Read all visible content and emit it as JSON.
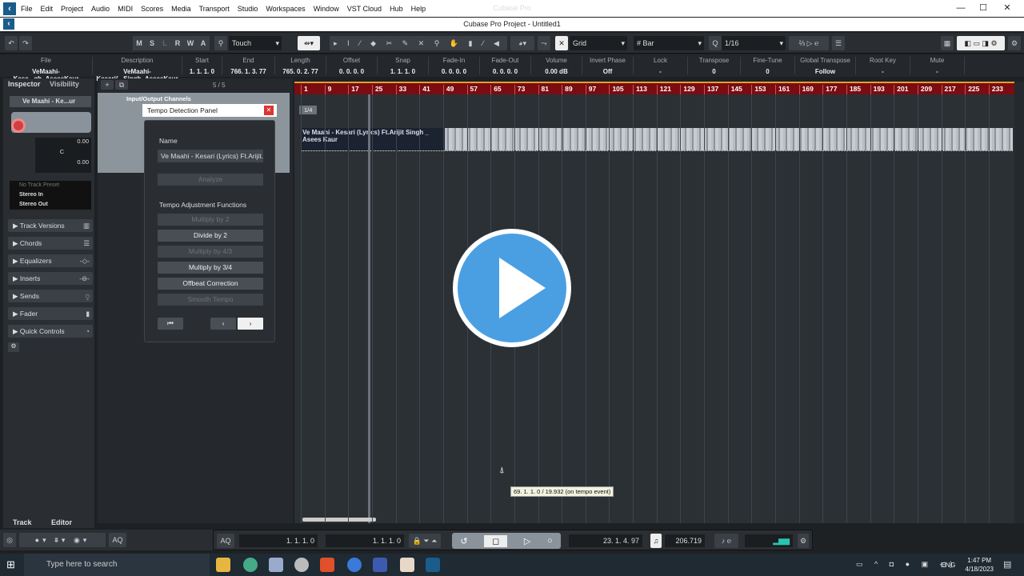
{
  "app": {
    "window_title": "Cubase Pro",
    "project_title": "Cubase Pro Project - Untitled1",
    "menu": [
      "File",
      "Edit",
      "Project",
      "Audio",
      "MIDI",
      "Scores",
      "Media",
      "Transport",
      "Studio",
      "Workspaces",
      "Window",
      "VST Cloud",
      "Hub",
      "Help"
    ]
  },
  "toolbar": {
    "modes": [
      "M",
      "S",
      "L",
      "R",
      "W",
      "A"
    ],
    "automation_mode": "Touch",
    "snap_type": "Grid",
    "grid_type": "Bar",
    "quantize": "1/16"
  },
  "infoline": [
    {
      "label": "File",
      "value": "VeMaahi-Kesa...gh_AseesKaur"
    },
    {
      "label": "Description",
      "value": "VeMaahi-Kesari(...Singh_AseesKaur"
    },
    {
      "label": "Start",
      "value": "1. 1. 1. 0"
    },
    {
      "label": "End",
      "value": "766. 1. 3. 77"
    },
    {
      "label": "Length",
      "value": "765. 0. 2. 77"
    },
    {
      "label": "Offset",
      "value": "0. 0. 0. 0"
    },
    {
      "label": "Snap",
      "value": "1. 1. 1. 0"
    },
    {
      "label": "Fade-In",
      "value": "0. 0. 0. 0"
    },
    {
      "label": "Fade-Out",
      "value": "0. 0. 0. 0"
    },
    {
      "label": "Volume",
      "value": "0.00   dB"
    },
    {
      "label": "Invert Phase",
      "value": "Off"
    },
    {
      "label": "Lock",
      "value": "-"
    },
    {
      "label": "Transpose",
      "value": "0"
    },
    {
      "label": "Fine-Tune",
      "value": "0"
    },
    {
      "label": "Global Transpose",
      "value": "Follow"
    },
    {
      "label": "Root Key",
      "value": "-"
    },
    {
      "label": "Mute",
      "value": "-"
    }
  ],
  "inspector": {
    "tab_inspector": "Inspector",
    "tab_visibility": "Visibility",
    "track_name": "Ve Maahi - Ke...ur",
    "volume": "0.00",
    "pan": "C",
    "delay": "0.00",
    "preset": "No Track Preset",
    "input": "Stereo In",
    "output": "Stereo Out",
    "sections": [
      "Track Versions",
      "Chords",
      "Equalizers",
      "Inserts",
      "Sends",
      "Fader",
      "Quick Controls"
    ],
    "bottom_tabs": [
      "Track",
      "Editor"
    ]
  },
  "tracklist": {
    "count": "5 / 5",
    "folder": "Input/Output Channels"
  },
  "dialog": {
    "title": "Tempo Detection Panel",
    "name_label": "Name",
    "name_value": "Ve Maahi - Kesari (Lyrics) Ft.Arijit.",
    "analyze": "Analyze",
    "functions_label": "Tempo Adjustment Functions",
    "buttons": [
      {
        "label": "Multiply by 2",
        "enabled": false
      },
      {
        "label": "Divide by 2",
        "enabled": true
      },
      {
        "label": "Multiply by 4/3",
        "enabled": false
      },
      {
        "label": "Multiply by 3/4",
        "enabled": true
      },
      {
        "label": "Offbeat Correction",
        "enabled": true
      },
      {
        "label": "Smooth Tempo",
        "enabled": false
      }
    ]
  },
  "arrange": {
    "ruler": [
      "1",
      "9",
      "17",
      "25",
      "33",
      "41",
      "49",
      "57",
      "65",
      "73",
      "81",
      "89",
      "97",
      "105",
      "113",
      "121",
      "129",
      "137",
      "145",
      "153",
      "161",
      "169",
      "177",
      "185",
      "193",
      "201",
      "209",
      "217",
      "225",
      "233"
    ],
    "signature": "1/4",
    "event_name": "Ve Maahi - Kesari (Lyrics) Ft.Arijit Singh _ Asees Kaur",
    "tooltip": "69. 1. 1. 0 / 19.932 (on tempo event)"
  },
  "transport": {
    "aq": "AQ",
    "left_locator": "1. 1. 1. 0",
    "right_locator": "1. 1. 1. 0",
    "position": "23. 1. 4. 97",
    "tempo": "206.719"
  },
  "taskbar": {
    "search_placeholder": "Type here to search",
    "lang": "ENG",
    "time": "1:47 PM",
    "date": "4/18/2023"
  },
  "colors": {
    "ruler": "#7a0c12",
    "play_overlay": "#4a9fe3",
    "record": "#d04040"
  }
}
